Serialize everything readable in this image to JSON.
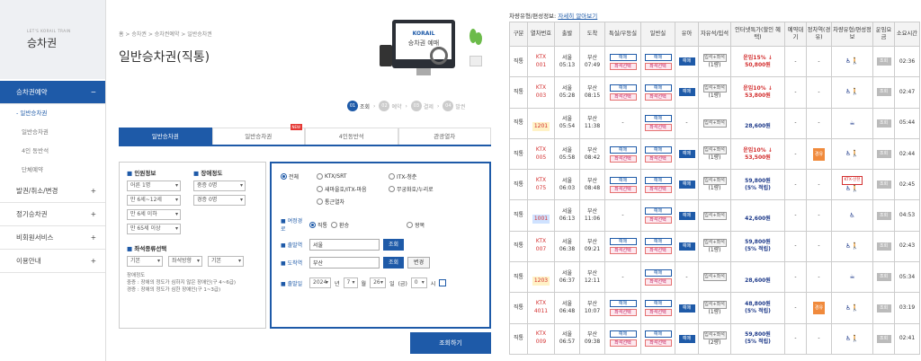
{
  "sidebar": {
    "brand_small": "LET'S KORAIL TRAIN",
    "brand_big": "승차권",
    "items": [
      {
        "label": "승차권예약",
        "sign": "−"
      },
      {
        "label": "발권/취소/변경",
        "sign": "+"
      },
      {
        "label": "정기승차권",
        "sign": "+"
      },
      {
        "label": "비회원서비스",
        "sign": "+"
      },
      {
        "label": "이용안내",
        "sign": "+"
      }
    ],
    "subs": [
      "- 일반승차권",
      "일반승차권",
      "4인 동반석",
      "단체예약"
    ]
  },
  "center": {
    "breadcrumb": "홈 > 승차권 > 승차권예약 > 일반승차권",
    "title": "일반승차권(직통)",
    "hero_logo": "KORAIL",
    "hero_text": "승차권 예매",
    "steps": [
      {
        "num": "01",
        "label": "조회"
      },
      {
        "num": "02",
        "label": "예약"
      },
      {
        "num": "03",
        "label": "결제"
      },
      {
        "num": "04",
        "label": "발권"
      }
    ],
    "tabs": [
      "일반승차권",
      "일반승차권",
      "4인동반석",
      "관광열차"
    ],
    "new_badge": "NEW",
    "passenger": {
      "heading": "인원정보",
      "options": [
        "어른 1명",
        "만 6세~12세",
        "만 6세 이하",
        "만 65세 이상"
      ]
    },
    "disabled": {
      "heading": "장애정도",
      "options": [
        "중증 0명",
        "경증 0명"
      ]
    },
    "seat": {
      "heading": "좌석종류선택",
      "options": [
        "기본",
        "좌석방향",
        "기본"
      ]
    },
    "notes": [
      "장애정도",
      "중증 : 장애의 정도가 심하지 않은 장애인(구 4~6급)",
      "경증 : 장애의 정도가 심한 장애인(구 1~3급)"
    ],
    "train_types": [
      "전체",
      "KTX/SRT",
      "ITX-청춘",
      "새마을호/ITX-마음",
      "무궁화호/누리로",
      "통근열차"
    ],
    "route_label": "여정경로",
    "route_options": [
      "직통",
      "환승",
      "왕복"
    ],
    "dep_label": "출발역",
    "dep_value": "서울",
    "arr_label": "도착역",
    "arr_value": "부산",
    "lookup_btn": "조회",
    "swap_btn": "변경",
    "date_label": "출발일",
    "date_year": "2024",
    "date_month": "7",
    "date_day": "26",
    "date_dow": "(금)",
    "date_hour": "0",
    "search_btn": "조회하기"
  },
  "timetable": {
    "header_prefix": "차량유형/편성정보:",
    "header_link": "자세히 알아보기",
    "columns": [
      "구분",
      "열차번호",
      "출발",
      "도착",
      "특실/우등실",
      "일반실",
      "유아",
      "자유석/입석",
      "인터넷특가(할인 혜택)",
      "예약대기",
      "정차역(경유)",
      "차량유형/편성정보",
      "운임요금",
      "소요시간"
    ],
    "rows": [
      {
        "type": "직통",
        "kind": "KTX",
        "no": "001",
        "dep_st": "서울",
        "dep_t": "05:13",
        "arr_st": "부산",
        "arr_t": "07:49",
        "prem": "예매",
        "gen": "예매",
        "baby": "예매",
        "free": "입석+좌석",
        "free2": "(1량)",
        "price_a": "운임15% ↓",
        "price_b": "50,800원",
        "style": "red",
        "wait": "-",
        "via": "-",
        "icons": "♿🚶",
        "fare": "조회",
        "dur": "02:36"
      },
      {
        "type": "직통",
        "kind": "KTX",
        "no": "003",
        "dep_st": "서울",
        "dep_t": "05:28",
        "arr_st": "부산",
        "arr_t": "08:15",
        "prem": "예매",
        "gen": "예매",
        "baby": "예매",
        "free": "입석+좌석",
        "free2": "(1량)",
        "price_a": "운임10% ↓",
        "price_b": "53,800원",
        "style": "red",
        "wait": "-",
        "via": "-",
        "icons": "♿🚶",
        "fare": "조회",
        "dur": "02:47"
      },
      {
        "type": "직통",
        "kind": "",
        "no": "1201",
        "dep_st": "서울",
        "dep_t": "05:54",
        "arr_st": "부산",
        "arr_t": "11:38",
        "prem": "",
        "gen": "예매",
        "baby": "",
        "free": "입석+좌석",
        "free2": "",
        "price_a": "",
        "price_b": "28,600원",
        "style": "yellow",
        "wait": "-",
        "via": "-",
        "icons": "☕",
        "fare": "조회",
        "dur": "05:44"
      },
      {
        "type": "직통",
        "kind": "KTX",
        "no": "005",
        "dep_st": "서울",
        "dep_t": "05:58",
        "arr_st": "부산",
        "arr_t": "08:42",
        "prem": "예매",
        "gen": "예매",
        "baby": "예매",
        "free": "입석+좌석",
        "free2": "(1량)",
        "price_a": "운임10% ↓",
        "price_b": "53,500원",
        "style": "red",
        "wait": "-",
        "via": "경유",
        "icons": "♿🚶",
        "fare": "조회",
        "dur": "02:44"
      },
      {
        "type": "직통",
        "kind": "KTX",
        "no": "075",
        "dep_st": "서울",
        "dep_t": "06:03",
        "arr_st": "부산",
        "arr_t": "08:48",
        "prem": "예매",
        "gen": "예매",
        "baby": "예매",
        "free": "입석+좌석",
        "free2": "(1량)",
        "price_a": "59,800원",
        "price_b": "(5% 적립)",
        "style": "blue",
        "wait": "-",
        "via": "-",
        "icons": "KTX-산천",
        "fare": "조회",
        "dur": "02:45"
      },
      {
        "type": "직통",
        "kind": "",
        "no": "1001",
        "dep_st": "서울",
        "dep_t": "06:13",
        "arr_st": "부산",
        "arr_t": "11:06",
        "prem": "",
        "gen": "예매",
        "baby": "예매",
        "free": "입석+좌석",
        "free2": "",
        "price_a": "",
        "price_b": "42,600원",
        "style": "lightblue",
        "wait": "-",
        "via": "-",
        "icons": "♿",
        "fare": "조회",
        "dur": "04:53"
      },
      {
        "type": "직통",
        "kind": "KTX",
        "no": "007",
        "dep_st": "서울",
        "dep_t": "06:38",
        "arr_st": "부산",
        "arr_t": "09:21",
        "prem": "예매",
        "gen": "예매",
        "baby": "예매",
        "free": "입석+좌석",
        "free2": "(1량)",
        "price_a": "59,800원",
        "price_b": "(5% 적립)",
        "style": "blue",
        "wait": "-",
        "via": "-",
        "icons": "♿🚶",
        "fare": "조회",
        "dur": "02:43"
      },
      {
        "type": "직통",
        "kind": "",
        "no": "1203",
        "dep_st": "서울",
        "dep_t": "06:37",
        "arr_st": "부산",
        "arr_t": "12:11",
        "prem": "",
        "gen": "예매",
        "baby": "",
        "free": "입석+좌석",
        "free2": "",
        "price_a": "",
        "price_b": "28,600원",
        "style": "yellow",
        "wait": "-",
        "via": "-",
        "icons": "☕",
        "fare": "조회",
        "dur": "05:34"
      },
      {
        "type": "직통",
        "kind": "KTX",
        "no": "4011",
        "dep_st": "서울",
        "dep_t": "06:48",
        "arr_st": "부산",
        "arr_t": "10:07",
        "prem": "예매",
        "gen": "예매",
        "baby": "예매",
        "free": "입석+좌석",
        "free2": "(1량)",
        "price_a": "48,800원",
        "price_b": "(5% 적립)",
        "style": "blue",
        "wait": "-",
        "via": "경유",
        "icons": "♿🚶",
        "fare": "조회",
        "dur": "03:19"
      },
      {
        "type": "직통",
        "kind": "KTX",
        "no": "009",
        "dep_st": "서울",
        "dep_t": "06:57",
        "arr_st": "부산",
        "arr_t": "09:38",
        "prem": "예매",
        "gen": "예매",
        "baby": "예매",
        "free": "입석+좌석",
        "free2": "(2량)",
        "price_a": "59,800원",
        "price_b": "(5% 적립)",
        "style": "blue",
        "wait": "-",
        "via": "-",
        "icons": "♿🚶",
        "fare": "조회",
        "dur": "02:41"
      }
    ]
  }
}
